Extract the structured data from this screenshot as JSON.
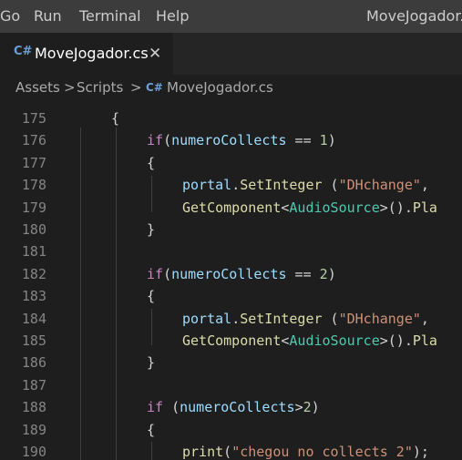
{
  "menu": [
    "Go",
    "Run",
    "Terminal",
    "Help"
  ],
  "window_title": "MoveJogador.cs",
  "tab": {
    "icon": "C#",
    "label": "MoveJogador.cs",
    "close": "✕"
  },
  "breadcrumb": {
    "items": [
      "Assets",
      "Scripts",
      "MoveJogador.cs"
    ],
    "separator": ">",
    "icon": "C#"
  },
  "code_lines": [
    {
      "n": "175",
      "tokens": [
        [
          "{",
          "pn"
        ]
      ]
    },
    {
      "n": "176",
      "tokens": [
        [
          "if",
          "kw"
        ],
        [
          "(",
          "pn"
        ],
        [
          "numeroCollects",
          "var"
        ],
        [
          " == ",
          "pn"
        ],
        [
          "1",
          "num"
        ],
        [
          ")",
          "pn"
        ]
      ]
    },
    {
      "n": "177",
      "tokens": [
        [
          "{",
          "pn"
        ]
      ]
    },
    {
      "n": "178",
      "tokens": [
        [
          "portal",
          "var"
        ],
        [
          ".",
          "pn"
        ],
        [
          "SetInteger",
          "fn"
        ],
        [
          " (",
          "pn"
        ],
        [
          "\"DHchange\"",
          "str"
        ],
        [
          ",",
          "pn"
        ]
      ]
    },
    {
      "n": "179",
      "tokens": [
        [
          "GetComponent",
          "fn"
        ],
        [
          "<",
          "pn"
        ],
        [
          "AudioSource",
          "typ"
        ],
        [
          ">().",
          "pn"
        ],
        [
          "Pla",
          "fn"
        ]
      ]
    },
    {
      "n": "180",
      "tokens": [
        [
          "}",
          "pn"
        ]
      ]
    },
    {
      "n": "181",
      "tokens": []
    },
    {
      "n": "182",
      "tokens": [
        [
          "if",
          "kw"
        ],
        [
          "(",
          "pn"
        ],
        [
          "numeroCollects",
          "var"
        ],
        [
          " == ",
          "pn"
        ],
        [
          "2",
          "num"
        ],
        [
          ")",
          "pn"
        ]
      ]
    },
    {
      "n": "183",
      "tokens": [
        [
          "{",
          "pn"
        ]
      ]
    },
    {
      "n": "184",
      "tokens": [
        [
          "portal",
          "var"
        ],
        [
          ".",
          "pn"
        ],
        [
          "SetInteger",
          "fn"
        ],
        [
          " (",
          "pn"
        ],
        [
          "\"DHchange\"",
          "str"
        ],
        [
          ",",
          "pn"
        ]
      ]
    },
    {
      "n": "185",
      "tokens": [
        [
          "GetComponent",
          "fn"
        ],
        [
          "<",
          "pn"
        ],
        [
          "AudioSource",
          "typ"
        ],
        [
          ">().",
          "pn"
        ],
        [
          "Pla",
          "fn"
        ]
      ]
    },
    {
      "n": "186",
      "tokens": [
        [
          "}",
          "pn"
        ]
      ]
    },
    {
      "n": "187",
      "tokens": []
    },
    {
      "n": "188",
      "tokens": [
        [
          "if",
          "kw"
        ],
        [
          " (",
          "pn"
        ],
        [
          "numeroCollects",
          "var"
        ],
        [
          ">",
          "pn"
        ],
        [
          "2",
          "num"
        ],
        [
          ")",
          "pn"
        ]
      ]
    },
    {
      "n": "189",
      "tokens": [
        [
          "{",
          "pn"
        ]
      ]
    },
    {
      "n": "190",
      "tokens": [
        [
          "print",
          "fn"
        ],
        [
          "(",
          "pn"
        ],
        [
          "\"chegou no collects 2\"",
          "str"
        ],
        [
          ");",
          "pn"
        ]
      ]
    }
  ],
  "colors": {
    "background": "#1e1e1e",
    "menubar": "#3c3c3c",
    "keyword": "#c586c0",
    "function": "#dcdcaa",
    "variable": "#9cdcfe",
    "string": "#ce9178",
    "type": "#4ec9b0",
    "number": "#b5cea8"
  }
}
